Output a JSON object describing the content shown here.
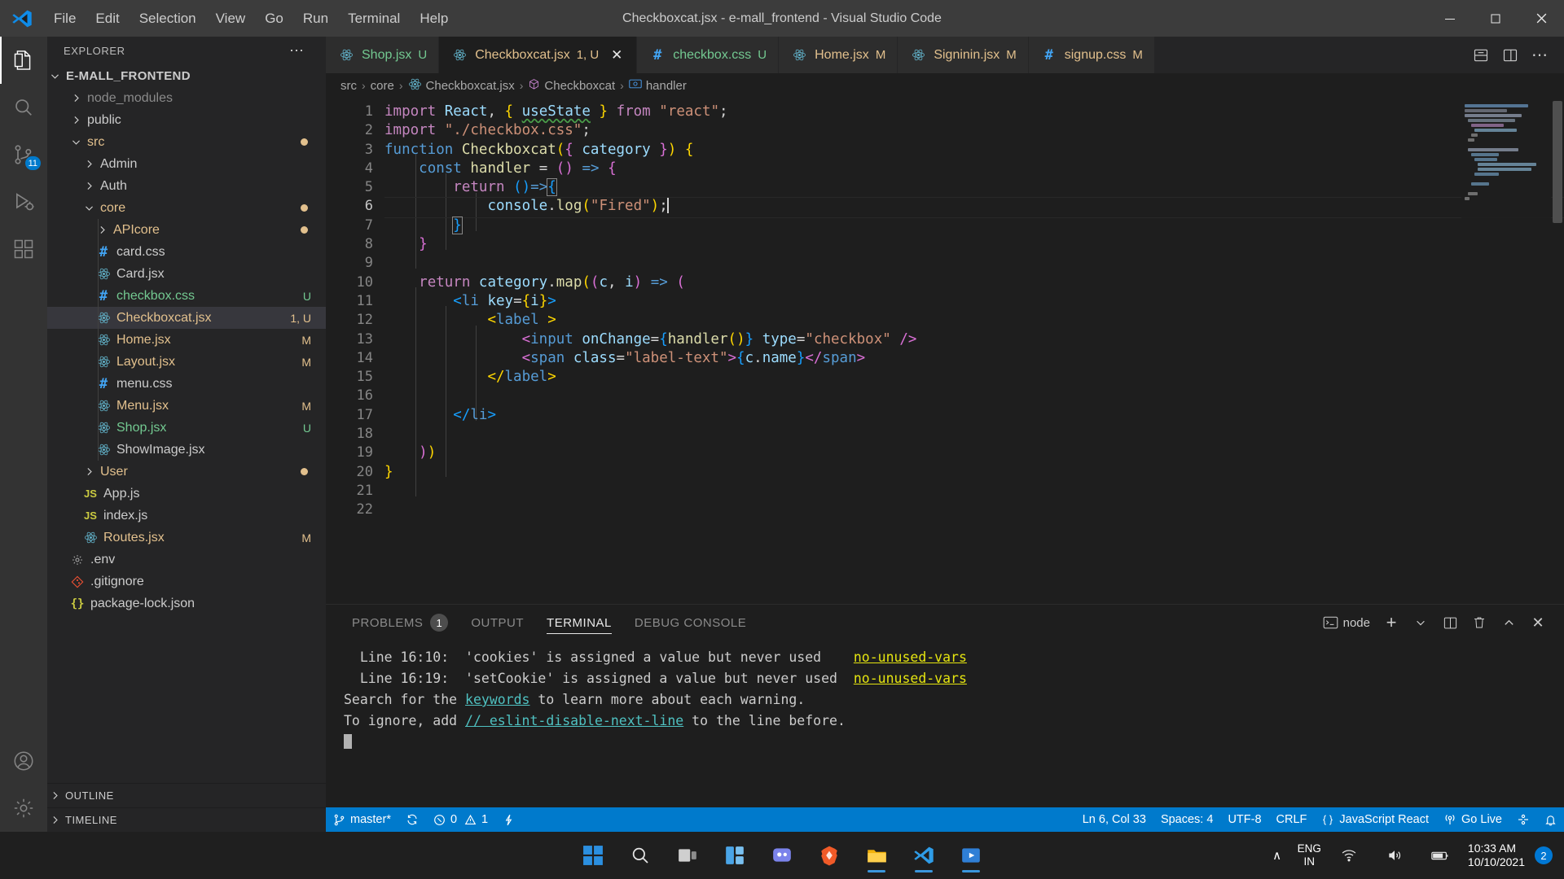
{
  "titlebar": {
    "menus": [
      "File",
      "Edit",
      "Selection",
      "View",
      "Go",
      "Run",
      "Terminal",
      "Help"
    ],
    "title": "Checkboxcat.jsx - e-mall_frontend - Visual Studio Code",
    "window_controls": {
      "minimize": "─",
      "maximize": "□",
      "close": "✕"
    }
  },
  "activitybar": {
    "items": [
      {
        "name": "explorer",
        "badge": ""
      },
      {
        "name": "search",
        "badge": ""
      },
      {
        "name": "source-control",
        "badge": "11"
      },
      {
        "name": "run-debug",
        "badge": ""
      },
      {
        "name": "extensions",
        "badge": ""
      }
    ],
    "bottom": [
      {
        "name": "accounts"
      },
      {
        "name": "settings"
      }
    ]
  },
  "sidebar": {
    "header": {
      "title": "EXPLORER",
      "more": "⋯"
    },
    "root": {
      "label": "E-MALL_FRONTEND",
      "expanded": true
    },
    "tree": [
      {
        "label": "node_modules",
        "type": "folder",
        "depth": 1,
        "expanded": false,
        "color": "#8a8a8a",
        "badge": "",
        "dot": ""
      },
      {
        "label": "public",
        "type": "folder",
        "depth": 1,
        "expanded": false,
        "color": "#cccccc",
        "badge": "",
        "dot": ""
      },
      {
        "label": "src",
        "type": "folder",
        "depth": 1,
        "expanded": true,
        "color": "#e2c08d",
        "badge": "",
        "dot": "#e2c08d"
      },
      {
        "label": "Admin",
        "type": "folder",
        "depth": 2,
        "expanded": false,
        "color": "#cccccc",
        "badge": "",
        "dot": ""
      },
      {
        "label": "Auth",
        "type": "folder",
        "depth": 2,
        "expanded": false,
        "color": "#cccccc",
        "badge": "",
        "dot": ""
      },
      {
        "label": "core",
        "type": "folder",
        "depth": 2,
        "expanded": true,
        "color": "#e2c08d",
        "badge": "",
        "dot": "#e2c08d"
      },
      {
        "label": "APIcore",
        "type": "folder",
        "depth": 3,
        "expanded": false,
        "color": "#e2c08d",
        "badge": "",
        "dot": "#e2c08d"
      },
      {
        "label": "card.css",
        "type": "css",
        "depth": 3,
        "color": "#cccccc",
        "badge": "",
        "dot": ""
      },
      {
        "label": "Card.jsx",
        "type": "jsx",
        "depth": 3,
        "color": "#cccccc",
        "badge": "",
        "dot": ""
      },
      {
        "label": "checkbox.css",
        "type": "css",
        "depth": 3,
        "color": "#73c991",
        "badge": "U",
        "badge_color": "#73c991",
        "dot": ""
      },
      {
        "label": "Checkboxcat.jsx",
        "type": "jsx",
        "depth": 3,
        "color": "#e2c08d",
        "badge": "1, U",
        "badge_color": "#e2c08d",
        "selected": true,
        "dot": ""
      },
      {
        "label": "Home.jsx",
        "type": "jsx",
        "depth": 3,
        "color": "#e2c08d",
        "badge": "M",
        "badge_color": "#e2c08d",
        "dot": ""
      },
      {
        "label": "Layout.jsx",
        "type": "jsx",
        "depth": 3,
        "color": "#e2c08d",
        "badge": "M",
        "badge_color": "#e2c08d",
        "dot": ""
      },
      {
        "label": "menu.css",
        "type": "css",
        "depth": 3,
        "color": "#cccccc",
        "badge": "",
        "dot": ""
      },
      {
        "label": "Menu.jsx",
        "type": "jsx",
        "depth": 3,
        "color": "#e2c08d",
        "badge": "M",
        "badge_color": "#e2c08d",
        "dot": ""
      },
      {
        "label": "Shop.jsx",
        "type": "jsx",
        "depth": 3,
        "color": "#73c991",
        "badge": "U",
        "badge_color": "#73c991",
        "dot": ""
      },
      {
        "label": "ShowImage.jsx",
        "type": "jsx",
        "depth": 3,
        "color": "#cccccc",
        "badge": "",
        "dot": ""
      },
      {
        "label": "User",
        "type": "folder",
        "depth": 2,
        "expanded": false,
        "color": "#e2c08d",
        "badge": "",
        "dot": "#e2c08d"
      },
      {
        "label": "App.js",
        "type": "js",
        "depth": 2,
        "color": "#cccccc",
        "badge": "",
        "dot": ""
      },
      {
        "label": "index.js",
        "type": "js",
        "depth": 2,
        "color": "#cccccc",
        "badge": "",
        "dot": ""
      },
      {
        "label": "Routes.jsx",
        "type": "jsx",
        "depth": 2,
        "color": "#e2c08d",
        "badge": "M",
        "badge_color": "#e2c08d",
        "dot": ""
      },
      {
        "label": ".env",
        "type": "gear",
        "depth": 1,
        "color": "#cccccc",
        "badge": "",
        "dot": ""
      },
      {
        "label": ".gitignore",
        "type": "git",
        "depth": 1,
        "color": "#cccccc",
        "badge": "",
        "dot": ""
      },
      {
        "label": "package-lock.json",
        "type": "json",
        "depth": 1,
        "color": "#cccccc",
        "badge": "",
        "dot": ""
      }
    ],
    "sections": [
      {
        "label": "OUTLINE",
        "expanded": false
      },
      {
        "label": "TIMELINE",
        "expanded": false
      }
    ]
  },
  "tabs": [
    {
      "name": "Shop.jsx",
      "icon": "react",
      "badge": "U",
      "color": "#73c991",
      "active": false,
      "close": false
    },
    {
      "name": "Checkboxcat.jsx",
      "icon": "react",
      "badge": "1, U",
      "color": "#e2c08d",
      "active": true,
      "close": true,
      "close_glyph": "✕"
    },
    {
      "name": "checkbox.css",
      "icon": "css",
      "badge": "U",
      "color": "#73c991",
      "active": false,
      "close": false
    },
    {
      "name": "Home.jsx",
      "icon": "react",
      "badge": "M",
      "color": "#e2c08d",
      "active": false,
      "close": false
    },
    {
      "name": "Signinin.jsx",
      "icon": "react",
      "badge": "M",
      "color": "#e2c08d",
      "active": false,
      "close": false
    },
    {
      "name": "signup.css",
      "icon": "css",
      "badge": "M",
      "color": "#e2c08d",
      "active": false,
      "close": false
    }
  ],
  "tabbar_actions": [
    {
      "name": "split-editor-down-icon"
    },
    {
      "name": "split-editor-right-icon"
    },
    {
      "name": "more-actions-icon",
      "glyph": "⋯"
    }
  ],
  "breadcrumb": [
    {
      "label": "src",
      "icon": "none"
    },
    {
      "label": "core",
      "icon": "none"
    },
    {
      "label": "Checkboxcat.jsx",
      "icon": "react"
    },
    {
      "label": "Checkboxcat",
      "icon": "class"
    },
    {
      "label": "handler",
      "icon": "method"
    }
  ],
  "editor": {
    "line_count": 22,
    "current_line": 6,
    "lines": [
      {
        "n": 1,
        "dot": ""
      },
      {
        "n": 2,
        "dot": ""
      },
      {
        "n": 3,
        "dot": "#b9a032"
      },
      {
        "n": 4,
        "dot": ""
      },
      {
        "n": 5,
        "dot": ""
      },
      {
        "n": 6,
        "dot": ""
      },
      {
        "n": 7,
        "dot": "#b9a032"
      },
      {
        "n": 8,
        "dot": "#8a7a5c"
      },
      {
        "n": 9,
        "dot": ""
      },
      {
        "n": 10,
        "dot": ""
      },
      {
        "n": 11,
        "dot": ""
      },
      {
        "n": 12,
        "dot": ""
      },
      {
        "n": 13,
        "dot": ""
      },
      {
        "n": 14,
        "dot": ""
      },
      {
        "n": 15,
        "dot": ""
      },
      {
        "n": 16,
        "dot": ""
      },
      {
        "n": 17,
        "dot": ""
      },
      {
        "n": 18,
        "dot": ""
      },
      {
        "n": 19,
        "dot": ""
      },
      {
        "n": 20,
        "dot": ""
      },
      {
        "n": 21,
        "dot": "#8a7a5c"
      },
      {
        "n": 22,
        "dot": ""
      }
    ],
    "source_text": [
      "import React, { useState } from \"react\";",
      "import \"./checkbox.css\";",
      "function Checkboxcat({ category }) {",
      "    const handler = () => {",
      "        return ()=>{",
      "            console.log(\"Fired\");",
      "        }",
      "    }",
      "",
      "    return category.map((c, i) => (",
      "        <li key={i}>",
      "            <label >",
      "                <input onChange={handler()} type=\"checkbox\" />",
      "                <span class=\"label-text\">{c.name}</span>",
      "            </label>",
      "",
      "        </li>",
      "",
      "    ))",
      "}",
      "",
      ""
    ]
  },
  "panel": {
    "tabs": [
      {
        "label": "PROBLEMS",
        "badge": "1",
        "active": false
      },
      {
        "label": "OUTPUT",
        "badge": "",
        "active": false
      },
      {
        "label": "TERMINAL",
        "badge": "",
        "active": true
      },
      {
        "label": "DEBUG CONSOLE",
        "badge": "",
        "active": false
      }
    ],
    "actions": {
      "shell_label": "node",
      "new_terminal": "+",
      "chevron": "∨",
      "split": "split-terminal",
      "kill": "trash",
      "maximize": "∧",
      "close": "✕"
    },
    "terminal_lines": [
      {
        "segments": [
          {
            "text": "  Line 16:10:  'cookies' is assigned a value but never used    ",
            "style": "plain"
          },
          {
            "text": "no-unused-vars",
            "style": "rule"
          }
        ]
      },
      {
        "segments": [
          {
            "text": "  Line 16:19:  'setCookie' is assigned a value but never used  ",
            "style": "plain"
          },
          {
            "text": "no-unused-vars",
            "style": "rule"
          }
        ]
      },
      {
        "segments": [
          {
            "text": "",
            "style": "plain"
          }
        ]
      },
      {
        "segments": [
          {
            "text": "Search for the ",
            "style": "plain"
          },
          {
            "text": "keywords",
            "style": "keyword"
          },
          {
            "text": " to learn more about each warning.",
            "style": "plain"
          }
        ]
      },
      {
        "segments": [
          {
            "text": "To ignore, add ",
            "style": "plain"
          },
          {
            "text": "// eslint-disable-next-line",
            "style": "keyword"
          },
          {
            "text": " to the line before.",
            "style": "plain"
          }
        ]
      },
      {
        "segments": [
          {
            "text": "",
            "style": "plain"
          }
        ]
      },
      {
        "segments": [
          {
            "text": "",
            "style": "cursor"
          }
        ]
      }
    ]
  },
  "statusbar": {
    "left": [
      {
        "name": "branch",
        "icon": "git-branch-icon",
        "label": "master*"
      },
      {
        "name": "sync",
        "icon": "sync-icon",
        "label": ""
      },
      {
        "name": "problems",
        "icon": "error-warning",
        "label": "0",
        "label2": "1"
      },
      {
        "name": "radon",
        "icon": "zap-icon",
        "label": ""
      }
    ],
    "right": [
      {
        "name": "cursor-position",
        "label": "Ln 6, Col 33"
      },
      {
        "name": "indentation",
        "label": "Spaces: 4"
      },
      {
        "name": "encoding",
        "label": "UTF-8"
      },
      {
        "name": "eol",
        "label": "CRLF"
      },
      {
        "name": "language-mode",
        "label": "JavaScript React",
        "icon": "braces-icon"
      },
      {
        "name": "go-live",
        "label": "Go Live",
        "icon": "broadcast-icon"
      },
      {
        "name": "remote",
        "label": "",
        "icon": "remote-icon"
      },
      {
        "name": "notifications",
        "label": "",
        "icon": "bell-icon"
      }
    ]
  },
  "taskbar": {
    "items": [
      {
        "name": "start-button",
        "icon": "windows"
      },
      {
        "name": "search-button",
        "icon": "search"
      },
      {
        "name": "task-view-button",
        "icon": "taskview"
      },
      {
        "name": "widgets-button",
        "icon": "widgets"
      },
      {
        "name": "teams-button",
        "icon": "teams"
      },
      {
        "name": "brave-button",
        "icon": "brave"
      },
      {
        "name": "explorer-button",
        "icon": "folder",
        "running": true
      },
      {
        "name": "vscode-button",
        "icon": "vscode",
        "running": true
      },
      {
        "name": "media-button",
        "icon": "media",
        "running": true
      }
    ],
    "tray": {
      "chevron": "∧",
      "lang_line1": "ENG",
      "lang_line2": "IN",
      "time": "10:33 AM",
      "date": "10/10/2021",
      "notification_count": "2"
    }
  },
  "colors": {
    "accent": "#007acc",
    "titlebar_bg": "#3c3c3c",
    "sidebar_bg": "#252526",
    "editor_bg": "#1e1e1e",
    "modified": "#e2c08d",
    "untracked": "#73c991"
  }
}
